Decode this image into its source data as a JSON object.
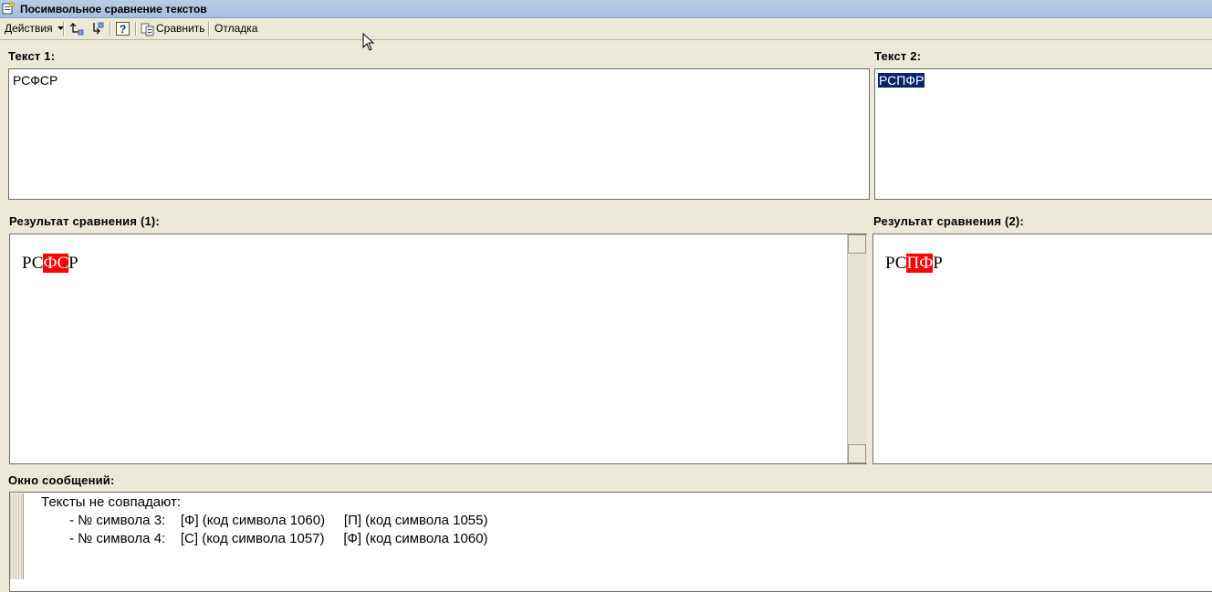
{
  "window": {
    "title": "Посимвольное сравнение текстов"
  },
  "toolbar": {
    "actions_label": "Действия",
    "compare_label": "Сравнить",
    "debug_label": "Отладка"
  },
  "text1": {
    "label": "Текст 1:",
    "value": "РСФСР"
  },
  "text2": {
    "label": "Текст 2:",
    "value": "РСПФР"
  },
  "result1": {
    "label": "Результат сравнения (1):",
    "prefix": "РС",
    "diff": "ФС",
    "suffix": "Р"
  },
  "result2": {
    "label": "Результат сравнения (2):",
    "prefix": "РС",
    "diff": "ПФ",
    "suffix": "Р"
  },
  "messages": {
    "label": "Окно сообщений:",
    "lines": [
      "Тексты не совпадают:",
      "- № символа 3:    [Ф] (код символа 1060)     [П] (код символа 1055)",
      "- № символа 4:    [С] (код символа 1057)     [Ф] (код символа 1060)"
    ]
  },
  "colors": {
    "diff_highlight": "#ff0000",
    "selection": "#0a246a"
  }
}
